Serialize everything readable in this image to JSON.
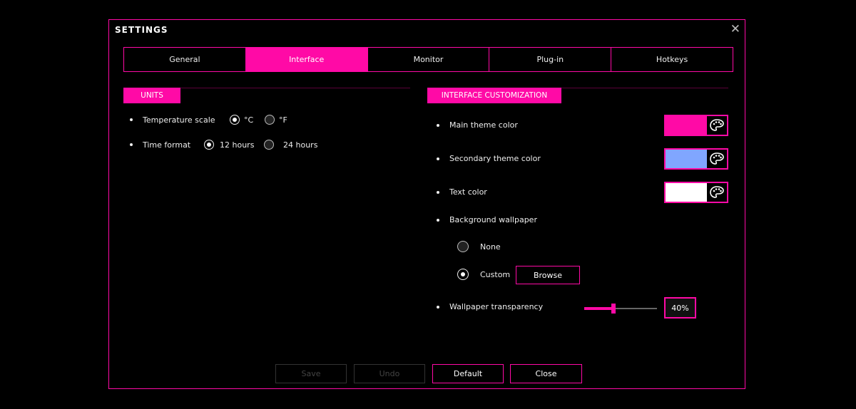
{
  "window": {
    "title": "SETTINGS",
    "close_icon": "close-icon"
  },
  "tabs": [
    {
      "label": "General",
      "active": false
    },
    {
      "label": "Interface",
      "active": true
    },
    {
      "label": "Monitor",
      "active": false
    },
    {
      "label": "Plug-in",
      "active": false
    },
    {
      "label": "Hotkeys",
      "active": false
    }
  ],
  "units": {
    "header": "UNITS",
    "temperature": {
      "label": "Temperature scale",
      "options": [
        "°C",
        "°F"
      ],
      "selected": "°C"
    },
    "time": {
      "label": "Time format",
      "options": [
        "12 hours",
        "24 hours"
      ],
      "selected": "12 hours"
    }
  },
  "interface": {
    "header": "INTERFACE CUSTOMIZATION",
    "main_theme": {
      "label": "Main theme color",
      "color": "#ff0aa6"
    },
    "secondary_theme": {
      "label": "Secondary theme color",
      "color": "#80a6ff"
    },
    "text_color": {
      "label": "Text color",
      "color": "#ffffff"
    },
    "wallpaper": {
      "label": "Background wallpaper",
      "options": [
        "None",
        "Custom"
      ],
      "selected": "Custom",
      "browse_label": "Browse"
    },
    "transparency": {
      "label": "Wallpaper transparency",
      "value": 40,
      "display": "40%"
    }
  },
  "footer": {
    "save": {
      "label": "Save",
      "enabled": false
    },
    "undo": {
      "label": "Undo",
      "enabled": false
    },
    "default": {
      "label": "Default",
      "enabled": true
    },
    "close": {
      "label": "Close",
      "enabled": true
    }
  },
  "colors": {
    "accent": "#ff0aa6"
  }
}
